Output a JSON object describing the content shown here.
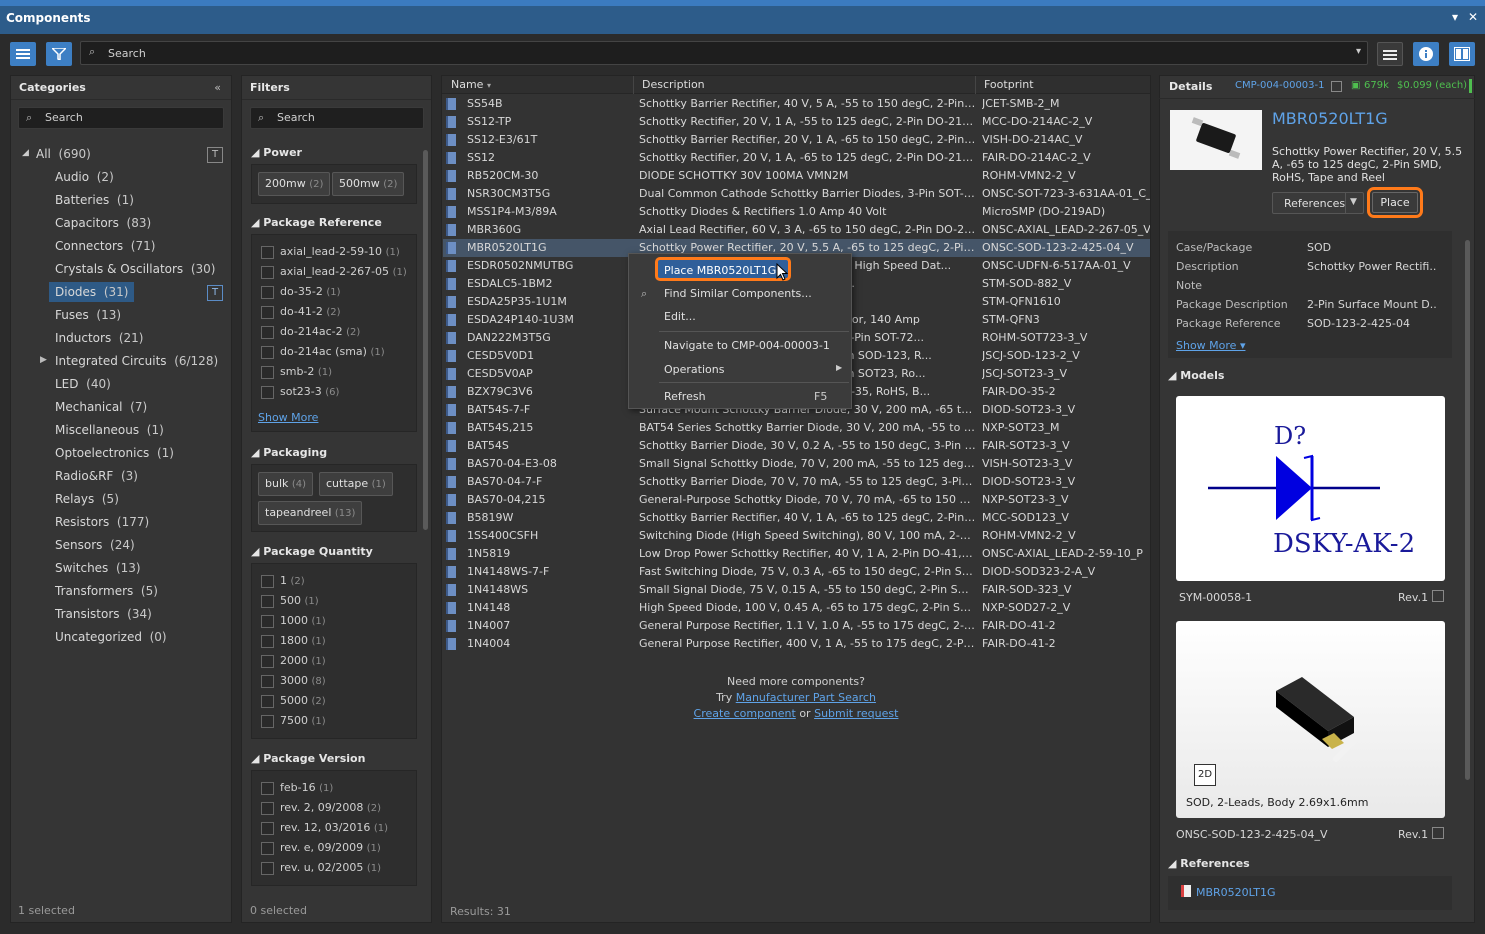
{
  "window": {
    "title": "Components",
    "ctl_menu": "▾",
    "ctl_close": "✕"
  },
  "toolbar": {
    "search_placeholder": "Search",
    "dropdown": "▾"
  },
  "categories": {
    "title": "Categories",
    "collapse": "«",
    "search": "Search",
    "footer": "1 selected",
    "items": [
      {
        "label": "All",
        "count": "(690)"
      },
      {
        "label": "Audio",
        "count": "(2)"
      },
      {
        "label": "Batteries",
        "count": "(1)"
      },
      {
        "label": "Capacitors",
        "count": "(83)"
      },
      {
        "label": "Connectors",
        "count": "(71)"
      },
      {
        "label": "Crystals & Oscillators",
        "count": "(30)"
      },
      {
        "label": "Diodes",
        "count": "(31)"
      },
      {
        "label": "Fuses",
        "count": "(13)"
      },
      {
        "label": "Inductors",
        "count": "(21)"
      },
      {
        "label": "Integrated Circuits",
        "count": "(6/128)"
      },
      {
        "label": "LED",
        "count": "(40)"
      },
      {
        "label": "Mechanical",
        "count": "(7)"
      },
      {
        "label": "Miscellaneous",
        "count": "(1)"
      },
      {
        "label": "Optoelectronics",
        "count": "(1)"
      },
      {
        "label": "Radio&RF",
        "count": "(3)"
      },
      {
        "label": "Relays",
        "count": "(5)"
      },
      {
        "label": "Resistors",
        "count": "(177)"
      },
      {
        "label": "Sensors",
        "count": "(24)"
      },
      {
        "label": "Switches",
        "count": "(13)"
      },
      {
        "label": "Transformers",
        "count": "(5)"
      },
      {
        "label": "Transistors",
        "count": "(34)"
      },
      {
        "label": "Uncategorized",
        "count": "(0)"
      }
    ]
  },
  "filters": {
    "title": "Filters",
    "search": "Search",
    "footer": "0 selected",
    "show_more": "Show More",
    "power": {
      "title": "Power",
      "chips": [
        {
          "label": "200mw",
          "count": "(2)"
        },
        {
          "label": "500mw",
          "count": "(2)"
        }
      ]
    },
    "package_reference": {
      "title": "Package Reference",
      "items": [
        {
          "label": "axial_lead-2-59-10",
          "count": "(1)"
        },
        {
          "label": "axial_lead-2-267-05",
          "count": "(1)"
        },
        {
          "label": "do-35-2",
          "count": "(1)"
        },
        {
          "label": "do-41-2",
          "count": "(2)"
        },
        {
          "label": "do-214ac-2",
          "count": "(2)"
        },
        {
          "label": "do-214ac (sma)",
          "count": "(1)"
        },
        {
          "label": "smb-2",
          "count": "(1)"
        },
        {
          "label": "sot23-3",
          "count": "(6)"
        }
      ]
    },
    "packaging": {
      "title": "Packaging",
      "chips": [
        {
          "label": "bulk",
          "count": "(4)"
        },
        {
          "label": "cuttape",
          "count": "(1)"
        },
        {
          "label": "tapeandreel",
          "count": "(13)"
        }
      ]
    },
    "package_quantity": {
      "title": "Package Quantity",
      "items": [
        {
          "label": "1",
          "count": "(2)"
        },
        {
          "label": "500",
          "count": "(1)"
        },
        {
          "label": "1000",
          "count": "(1)"
        },
        {
          "label": "1800",
          "count": "(1)"
        },
        {
          "label": "2000",
          "count": "(1)"
        },
        {
          "label": "3000",
          "count": "(8)"
        },
        {
          "label": "5000",
          "count": "(2)"
        },
        {
          "label": "7500",
          "count": "(1)"
        }
      ]
    },
    "package_version": {
      "title": "Package Version",
      "items": [
        {
          "label": "feb-16",
          "count": "(1)"
        },
        {
          "label": "rev. 2, 09/2008",
          "count": "(2)"
        },
        {
          "label": "rev. 12, 03/2016",
          "count": "(1)"
        },
        {
          "label": "rev. e, 09/2009",
          "count": "(1)"
        },
        {
          "label": "rev. u, 02/2005",
          "count": "(1)"
        }
      ]
    }
  },
  "grid": {
    "col_name": "Name",
    "col_desc": "Description",
    "col_footprint": "Footprint",
    "results": "Results: 31",
    "more_title": "Need more components?",
    "more_try": "Try",
    "more_mps": "Manufacturer Part Search",
    "more_create": "Create component",
    "more_or": "or",
    "more_submit": "Submit request",
    "rows": [
      {
        "name": "SS54B",
        "desc": "Schottky Barrier Rectifier, 40 V, 5 A, -55 to 150 degC, 2-Pin SMD",
        "fp": "JCET-SMB-2_M"
      },
      {
        "name": "SS12-TP",
        "desc": "Schottky Rectifier, 20 V, 1 A, -55 to 125 degC, 2-Pin DO-214AC, R...",
        "fp": "MCC-DO-214AC-2_V"
      },
      {
        "name": "SS12-E3/61T",
        "desc": "Schottky Barrier Rectifier, 20 V, 1 A, -65 to 150 degC, 2-Pin DO-2...",
        "fp": "VISH-DO-214AC_V"
      },
      {
        "name": "SS12",
        "desc": "Schottky Rectifier, 20 V, 1 A, -65 to 125 degC, 2-Pin DO-214AC, R...",
        "fp": "FAIR-DO-214AC-2_V"
      },
      {
        "name": "RB520CM-30",
        "desc": "DIODE SCHOTTKY 30V 100MA VMN2M",
        "fp": "ROHM-VMN2-2_V"
      },
      {
        "name": "NSR30CM3T5G",
        "desc": "Dual Common Cathode Schottky Barrier Diodes, 3-Pin SOT-723,...",
        "fp": "ONSC-SOT-723-3-631AA-01_C_V"
      },
      {
        "name": "MSS1P4-M3/89A",
        "desc": "Schottky Diodes & Rectifiers 1.0 Amp 40 Volt",
        "fp": "MicroSMP (DO-219AD)"
      },
      {
        "name": "MBR360G",
        "desc": "Axial Lead Rectifier, 60 V, 3 A, -65 to 150 degC, 2-Pin DO-201AD,...",
        "fp": "ONSC-AXIAL_LEAD-2-267-05_V"
      },
      {
        "name": "MBR0520LT1G",
        "desc": "Schottky Power Rectifier, 20 V, 5.5 A, -65 to 125 degC, 2-Pin SM...",
        "fp": "ONSC-SOD-123-2-425-04_V"
      },
      {
        "name": "ESDR0502NMUTBG",
        "desc": "Transient Voltage Suppressor Array for High Speed Dat...",
        "fp": "ONSC-UDFN-6-517AA-01_V"
      },
      {
        "name": "ESDALC5-1BM2",
        "desc": "ESD protection, -55 to 150 degC, 2-Pi...",
        "fp": "STM-SOD-882_V"
      },
      {
        "name": "ESDA25P35-1U1M",
        "desc": "",
        "fp": "STM-QFN1610"
      },
      {
        "name": "ESDA24P140-1U3M",
        "desc": "High power transient voltage suppressor, 140 Amp",
        "fp": "STM-QFN3"
      },
      {
        "name": "DAN222M3T5G",
        "desc": "Common Cathode Switching Diodes, 3-Pin SOT-72...",
        "fp": "ROHM-SOT723-3_V"
      },
      {
        "name": "CESD5V0D1",
        "desc": "ESD Protection Diode, 5 V, 25 uA, 2-Pin SOD-123, R...",
        "fp": "JSCJ-SOD-123-2_V"
      },
      {
        "name": "CESD5V0AP",
        "desc": "ESD Protection Diode, 5 V, 10 uA, 3-Pin SOT23, Ro...",
        "fp": "JSCJ-SOT23-3_V"
      },
      {
        "name": "BZX79C3V6",
        "desc": "Zener Diode, 3.6 V, 500 mW, 2-Pin DO-35, RoHS, B...",
        "fp": "FAIR-DO-35-2"
      },
      {
        "name": "BAT54S-7-F",
        "desc": "Surface Mount Schottky Barrier Diode, 30 V, 200 mA, -65 to 150...",
        "fp": "DIOD-SOT23-3_V"
      },
      {
        "name": "BAT54S,215",
        "desc": "BAT54 Series Schottky Barrier Diode, 30 V, 200 mA, -55 to 150 de...",
        "fp": "NXP-SOT23_M"
      },
      {
        "name": "BAT54S",
        "desc": "Schottky Barrier Diode, 30 V, 0.2 A, -55 to 150 degC, 3-Pin SOT2...",
        "fp": "FAIR-SOT23-3_V"
      },
      {
        "name": "BAS70-04-E3-08",
        "desc": "Small Signal Schottky Diode, 70 V, 200 mA, -55 to 125 degC, 3-Pi...",
        "fp": "VISH-SOT23-3_V"
      },
      {
        "name": "BAS70-04-7-F",
        "desc": "Schottky Barrier Diode, 70 V, 70 mA, -55 to 125 degC, 3-Pin SOT...",
        "fp": "DIOD-SOT23-3_V"
      },
      {
        "name": "BAS70-04,215",
        "desc": "General-Purpose Schottky Diode, 70 V, 70 mA, -65 to 150 degC,...",
        "fp": "NXP-SOT23-3_V"
      },
      {
        "name": "B5819W",
        "desc": "Schottky Barrier Rectifier, 40 V, 1 A, -65 to 125 degC, 2-Pin SOD1...",
        "fp": "MCC-SOD123_V"
      },
      {
        "name": "1SS400CSFH",
        "desc": "Switching Diode (High Speed Switching), 80 V, 100 mA, 2-Pin S...",
        "fp": "ROHM-VMN2-2_V"
      },
      {
        "name": "1N5819",
        "desc": "Low Drop Power Schottky Rectifier, 40 V, 1 A, 2-Pin DO-41, RoHS",
        "fp": "ONSC-AXIAL_LEAD-2-59-10_P"
      },
      {
        "name": "1N4148WS-7-F",
        "desc": "Fast Switching Diode, 75 V, 0.3 A, -65 to 150 degC, 2-Pin SOD32...",
        "fp": "DIOD-SOD323-2-A_V"
      },
      {
        "name": "1N4148WS",
        "desc": "Small Signal Diode, 75 V, 0.15 A, -55 to 150 degC, 2-Pin SOD-32...",
        "fp": "FAIR-SOD-323_V"
      },
      {
        "name": "1N4148",
        "desc": "High Speed Diode, 100 V, 0.45 A, -65 to 175 degC, 2-Pin SOD27,...",
        "fp": "NXP-SOD27-2_V"
      },
      {
        "name": "1N4007",
        "desc": "General Purpose Rectifier, 1.1 V, 1.0 A, -55 to 175 degC, 2-Pin D...",
        "fp": "FAIR-DO-41-2"
      },
      {
        "name": "1N4004",
        "desc": "General Purpose Rectifier, 400 V, 1 A, -55 to 175 degC, 2-Pin DO...",
        "fp": "FAIR-DO-41-2"
      }
    ]
  },
  "context_menu": {
    "place": "Place MBR0520LT1G",
    "find": "Find Similar Components...",
    "edit": "Edit...",
    "navigate": "Navigate to CMP-004-00003-1",
    "operations": "Operations",
    "refresh": "Refresh",
    "refresh_key": "F5"
  },
  "details": {
    "title": "Details",
    "id": "CMP-004-00003-1",
    "stock": "679k",
    "price": "$0.099 (each)",
    "part": "MBR0520LT1G",
    "summary": "Schottky Power Rectifier, 20 V, 5.5 A, -65 to 125 degC, 2-Pin SMD, RoHS, Tape and Reel",
    "references_btn": "References",
    "place_btn": "Place",
    "show_more": "Show More ▾",
    "props": [
      {
        "label": "Case/Package",
        "value": "SOD"
      },
      {
        "label": "Description",
        "value": "Schottky Power Rectifi..."
      },
      {
        "label": "Note",
        "value": ""
      },
      {
        "label": "Package Description",
        "value": "2-Pin Surface Mount D..."
      },
      {
        "label": "Package Reference",
        "value": "SOD-123-2-425-04"
      }
    ],
    "models_title": "Models",
    "symbol": {
      "designator": "D?",
      "name": "DSKY-AK-2",
      "id": "SYM-00058-1",
      "rev": "Rev.1"
    },
    "footprint": {
      "badge": "2D",
      "caption": "SOD, 2-Leads, Body 2.69x1.6mm",
      "id": "ONSC-SOD-123-2-425-04_V",
      "rev": "Rev.1"
    },
    "references_title": "References",
    "reference_item": "MBR0520LT1G"
  },
  "colors": {
    "accent": "#3d7fc4",
    "highlight": "#ff7a1a",
    "selection": "#455568"
  }
}
